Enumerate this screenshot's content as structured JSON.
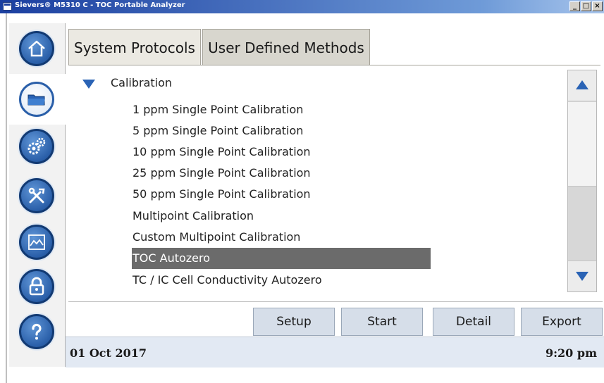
{
  "window": {
    "title": "Sievers® M5310 C - TOC Portable Analyzer",
    "controls": {
      "minimize": "_",
      "maximize": "□",
      "close": "×"
    }
  },
  "sidebar": {
    "items": [
      {
        "icon": "home-icon"
      },
      {
        "icon": "folder-icon",
        "active": true
      },
      {
        "icon": "gears-icon"
      },
      {
        "icon": "tools-icon"
      },
      {
        "icon": "chart-icon"
      },
      {
        "icon": "lock-icon"
      },
      {
        "icon": "help-icon"
      }
    ]
  },
  "tabs": [
    {
      "label": "System Protocols",
      "active": true
    },
    {
      "label": "User Defined Methods",
      "active": false
    }
  ],
  "list": {
    "group_label": "Calibration",
    "items": [
      "1 ppm Single Point Calibration",
      "5 ppm Single Point Calibration",
      "10 ppm Single Point Calibration",
      "25 ppm Single Point Calibration",
      "50 ppm Single Point Calibration",
      "Multipoint Calibration",
      "Custom Multipoint Calibration",
      "TOC Autozero",
      "TC / IC Cell Conductivity Autozero"
    ],
    "selected_index": 7
  },
  "actions": {
    "setup": "Setup",
    "start": "Start",
    "detail": "Detail",
    "export": "Export"
  },
  "status": {
    "date": "01 Oct 2017",
    "time": "9:20 pm"
  },
  "colors": {
    "accent_blue": "#2a63b5",
    "selection_gray": "#6b6b6b",
    "tab_bg": "#d8d6ce",
    "status_bg": "#e2e9f3"
  }
}
